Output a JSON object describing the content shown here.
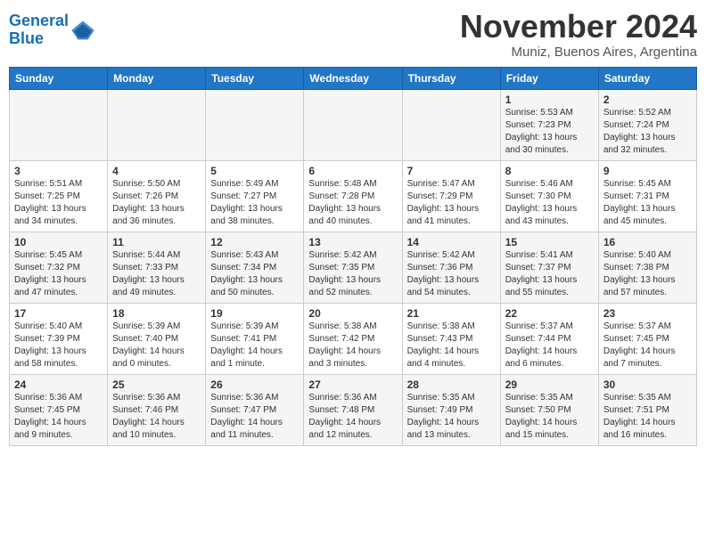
{
  "header": {
    "logo_line1": "General",
    "logo_line2": "Blue",
    "month_title": "November 2024",
    "location": "Muniz, Buenos Aires, Argentina"
  },
  "weekdays": [
    "Sunday",
    "Monday",
    "Tuesday",
    "Wednesday",
    "Thursday",
    "Friday",
    "Saturday"
  ],
  "weeks": [
    [
      {
        "day": "",
        "info": ""
      },
      {
        "day": "",
        "info": ""
      },
      {
        "day": "",
        "info": ""
      },
      {
        "day": "",
        "info": ""
      },
      {
        "day": "",
        "info": ""
      },
      {
        "day": "1",
        "info": "Sunrise: 5:53 AM\nSunset: 7:23 PM\nDaylight: 13 hours\nand 30 minutes."
      },
      {
        "day": "2",
        "info": "Sunrise: 5:52 AM\nSunset: 7:24 PM\nDaylight: 13 hours\nand 32 minutes."
      }
    ],
    [
      {
        "day": "3",
        "info": "Sunrise: 5:51 AM\nSunset: 7:25 PM\nDaylight: 13 hours\nand 34 minutes."
      },
      {
        "day": "4",
        "info": "Sunrise: 5:50 AM\nSunset: 7:26 PM\nDaylight: 13 hours\nand 36 minutes."
      },
      {
        "day": "5",
        "info": "Sunrise: 5:49 AM\nSunset: 7:27 PM\nDaylight: 13 hours\nand 38 minutes."
      },
      {
        "day": "6",
        "info": "Sunrise: 5:48 AM\nSunset: 7:28 PM\nDaylight: 13 hours\nand 40 minutes."
      },
      {
        "day": "7",
        "info": "Sunrise: 5:47 AM\nSunset: 7:29 PM\nDaylight: 13 hours\nand 41 minutes."
      },
      {
        "day": "8",
        "info": "Sunrise: 5:46 AM\nSunset: 7:30 PM\nDaylight: 13 hours\nand 43 minutes."
      },
      {
        "day": "9",
        "info": "Sunrise: 5:45 AM\nSunset: 7:31 PM\nDaylight: 13 hours\nand 45 minutes."
      }
    ],
    [
      {
        "day": "10",
        "info": "Sunrise: 5:45 AM\nSunset: 7:32 PM\nDaylight: 13 hours\nand 47 minutes."
      },
      {
        "day": "11",
        "info": "Sunrise: 5:44 AM\nSunset: 7:33 PM\nDaylight: 13 hours\nand 49 minutes."
      },
      {
        "day": "12",
        "info": "Sunrise: 5:43 AM\nSunset: 7:34 PM\nDaylight: 13 hours\nand 50 minutes."
      },
      {
        "day": "13",
        "info": "Sunrise: 5:42 AM\nSunset: 7:35 PM\nDaylight: 13 hours\nand 52 minutes."
      },
      {
        "day": "14",
        "info": "Sunrise: 5:42 AM\nSunset: 7:36 PM\nDaylight: 13 hours\nand 54 minutes."
      },
      {
        "day": "15",
        "info": "Sunrise: 5:41 AM\nSunset: 7:37 PM\nDaylight: 13 hours\nand 55 minutes."
      },
      {
        "day": "16",
        "info": "Sunrise: 5:40 AM\nSunset: 7:38 PM\nDaylight: 13 hours\nand 57 minutes."
      }
    ],
    [
      {
        "day": "17",
        "info": "Sunrise: 5:40 AM\nSunset: 7:39 PM\nDaylight: 13 hours\nand 58 minutes."
      },
      {
        "day": "18",
        "info": "Sunrise: 5:39 AM\nSunset: 7:40 PM\nDaylight: 14 hours\nand 0 minutes."
      },
      {
        "day": "19",
        "info": "Sunrise: 5:39 AM\nSunset: 7:41 PM\nDaylight: 14 hours\nand 1 minute."
      },
      {
        "day": "20",
        "info": "Sunrise: 5:38 AM\nSunset: 7:42 PM\nDaylight: 14 hours\nand 3 minutes."
      },
      {
        "day": "21",
        "info": "Sunrise: 5:38 AM\nSunset: 7:43 PM\nDaylight: 14 hours\nand 4 minutes."
      },
      {
        "day": "22",
        "info": "Sunrise: 5:37 AM\nSunset: 7:44 PM\nDaylight: 14 hours\nand 6 minutes."
      },
      {
        "day": "23",
        "info": "Sunrise: 5:37 AM\nSunset: 7:45 PM\nDaylight: 14 hours\nand 7 minutes."
      }
    ],
    [
      {
        "day": "24",
        "info": "Sunrise: 5:36 AM\nSunset: 7:45 PM\nDaylight: 14 hours\nand 9 minutes."
      },
      {
        "day": "25",
        "info": "Sunrise: 5:36 AM\nSunset: 7:46 PM\nDaylight: 14 hours\nand 10 minutes."
      },
      {
        "day": "26",
        "info": "Sunrise: 5:36 AM\nSunset: 7:47 PM\nDaylight: 14 hours\nand 11 minutes."
      },
      {
        "day": "27",
        "info": "Sunrise: 5:36 AM\nSunset: 7:48 PM\nDaylight: 14 hours\nand 12 minutes."
      },
      {
        "day": "28",
        "info": "Sunrise: 5:35 AM\nSunset: 7:49 PM\nDaylight: 14 hours\nand 13 minutes."
      },
      {
        "day": "29",
        "info": "Sunrise: 5:35 AM\nSunset: 7:50 PM\nDaylight: 14 hours\nand 15 minutes."
      },
      {
        "day": "30",
        "info": "Sunrise: 5:35 AM\nSunset: 7:51 PM\nDaylight: 14 hours\nand 16 minutes."
      }
    ]
  ]
}
